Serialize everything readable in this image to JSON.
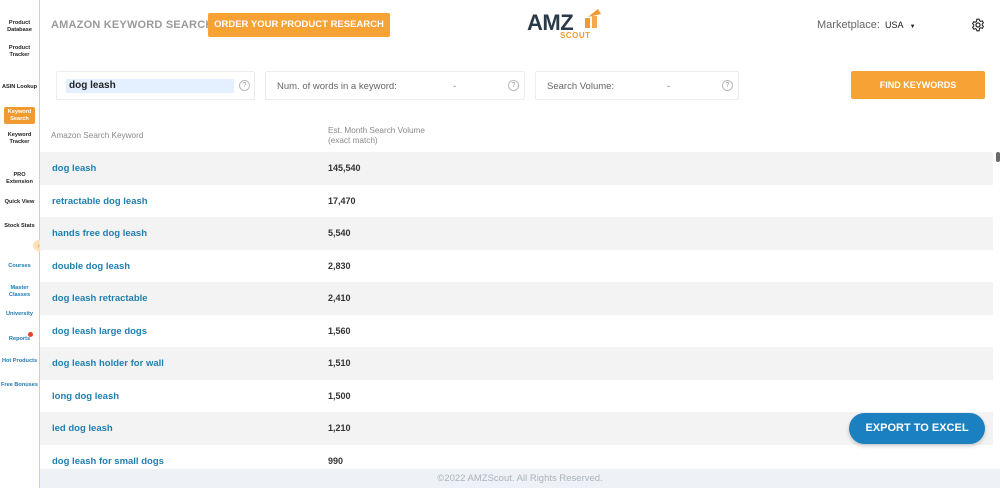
{
  "sidebar": {
    "items": [
      {
        "label": "Product Database"
      },
      {
        "label": "Product Tracker"
      },
      {
        "label": "ASIN Lookup"
      },
      {
        "label": "Keyword Search"
      },
      {
        "label": "Keyword Tracker"
      },
      {
        "label": "PRO Extension"
      },
      {
        "label": "Quick View"
      },
      {
        "label": "Stock Stats"
      },
      {
        "label": "Courses"
      },
      {
        "label": "Master Classes"
      },
      {
        "label": "University"
      },
      {
        "label": "Reports"
      },
      {
        "label": "Hot Products"
      },
      {
        "label": "Free Bonuses"
      }
    ],
    "toggle_icon": "chevron-right-icon"
  },
  "header": {
    "title": "AMAZON KEYWORD SEARCH",
    "order_button": "ORDER YOUR PRODUCT RESEARCH",
    "logo_main": "AMZ",
    "logo_sub": "SCOUT",
    "marketplace_label": "Marketplace:",
    "marketplace_value": "USA",
    "settings_icon": "gear-icon"
  },
  "search": {
    "keyword_value": "dog leash",
    "words_label": "Num. of words in a keyword:",
    "words_value": "-",
    "volume_label": "Search Volume:",
    "volume_value": "-",
    "help_icon": "?",
    "find_button": "FIND KEYWORDS"
  },
  "table": {
    "col_keyword": "Amazon Search Keyword",
    "col_volume_line1": "Est. Month Search Volume",
    "col_volume_line2": "(exact match)",
    "rows": [
      {
        "keyword": "dog leash",
        "volume": "145,540"
      },
      {
        "keyword": "retractable dog leash",
        "volume": "17,470"
      },
      {
        "keyword": "hands free dog leash",
        "volume": "5,540"
      },
      {
        "keyword": "double dog leash",
        "volume": "2,830"
      },
      {
        "keyword": "dog leash retractable",
        "volume": "2,410"
      },
      {
        "keyword": "dog leash large dogs",
        "volume": "1,560"
      },
      {
        "keyword": "dog leash holder for wall",
        "volume": "1,510"
      },
      {
        "keyword": "long dog leash",
        "volume": "1,500"
      },
      {
        "keyword": "led dog leash",
        "volume": "1,210"
      },
      {
        "keyword": "dog leash for small dogs",
        "volume": "990"
      }
    ]
  },
  "export_button": "EXPORT TO EXCEL",
  "footer": "©2022 AMZScout. All Rights Reserved.",
  "colors": {
    "accent_orange": "#f7a234",
    "link_blue": "#1f7fb0",
    "export_blue": "#1a80c0"
  }
}
